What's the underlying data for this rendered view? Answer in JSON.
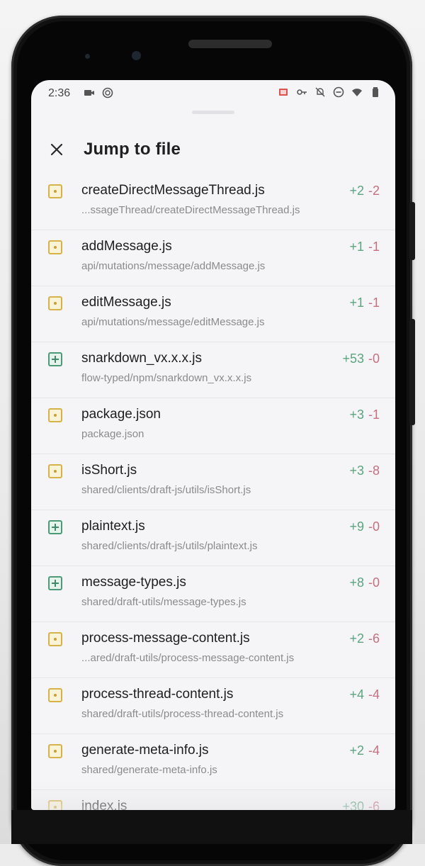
{
  "status_bar": {
    "time": "2:36"
  },
  "header": {
    "title": "Jump to file",
    "close_icon": "close-icon"
  },
  "colors": {
    "added": "#5aa57f",
    "deleted": "#c47080",
    "modified_icon": "#d6b34a",
    "added_icon": "#4c9a78"
  },
  "files": [
    {
      "name": "createDirectMessageThread.js",
      "path": "...ssageThread/createDirectMessageThread.js",
      "added": "+2",
      "deleted": "-2",
      "status": "modified"
    },
    {
      "name": "addMessage.js",
      "path": "api/mutations/message/addMessage.js",
      "added": "+1",
      "deleted": "-1",
      "status": "modified"
    },
    {
      "name": "editMessage.js",
      "path": "api/mutations/message/editMessage.js",
      "added": "+1",
      "deleted": "-1",
      "status": "modified"
    },
    {
      "name": "snarkdown_vx.x.x.js",
      "path": "flow-typed/npm/snarkdown_vx.x.x.js",
      "added": "+53",
      "deleted": "-0",
      "status": "added"
    },
    {
      "name": "package.json",
      "path": "package.json",
      "added": "+3",
      "deleted": "-1",
      "status": "modified"
    },
    {
      "name": "isShort.js",
      "path": "shared/clients/draft-js/utils/isShort.js",
      "added": "+3",
      "deleted": "-8",
      "status": "modified"
    },
    {
      "name": "plaintext.js",
      "path": "shared/clients/draft-js/utils/plaintext.js",
      "added": "+9",
      "deleted": "-0",
      "status": "added"
    },
    {
      "name": "message-types.js",
      "path": "shared/draft-utils/message-types.js",
      "added": "+8",
      "deleted": "-0",
      "status": "added"
    },
    {
      "name": "process-message-content.js",
      "path": "...ared/draft-utils/process-message-content.js",
      "added": "+2",
      "deleted": "-6",
      "status": "modified"
    },
    {
      "name": "process-thread-content.js",
      "path": "shared/draft-utils/process-thread-content.js",
      "added": "+4",
      "deleted": "-4",
      "status": "modified"
    },
    {
      "name": "generate-meta-info.js",
      "path": "shared/generate-meta-info.js",
      "added": "+2",
      "deleted": "-4",
      "status": "modified"
    },
    {
      "name": "index.js",
      "path": "",
      "added": "+30",
      "deleted": "-6",
      "status": "modified"
    }
  ]
}
